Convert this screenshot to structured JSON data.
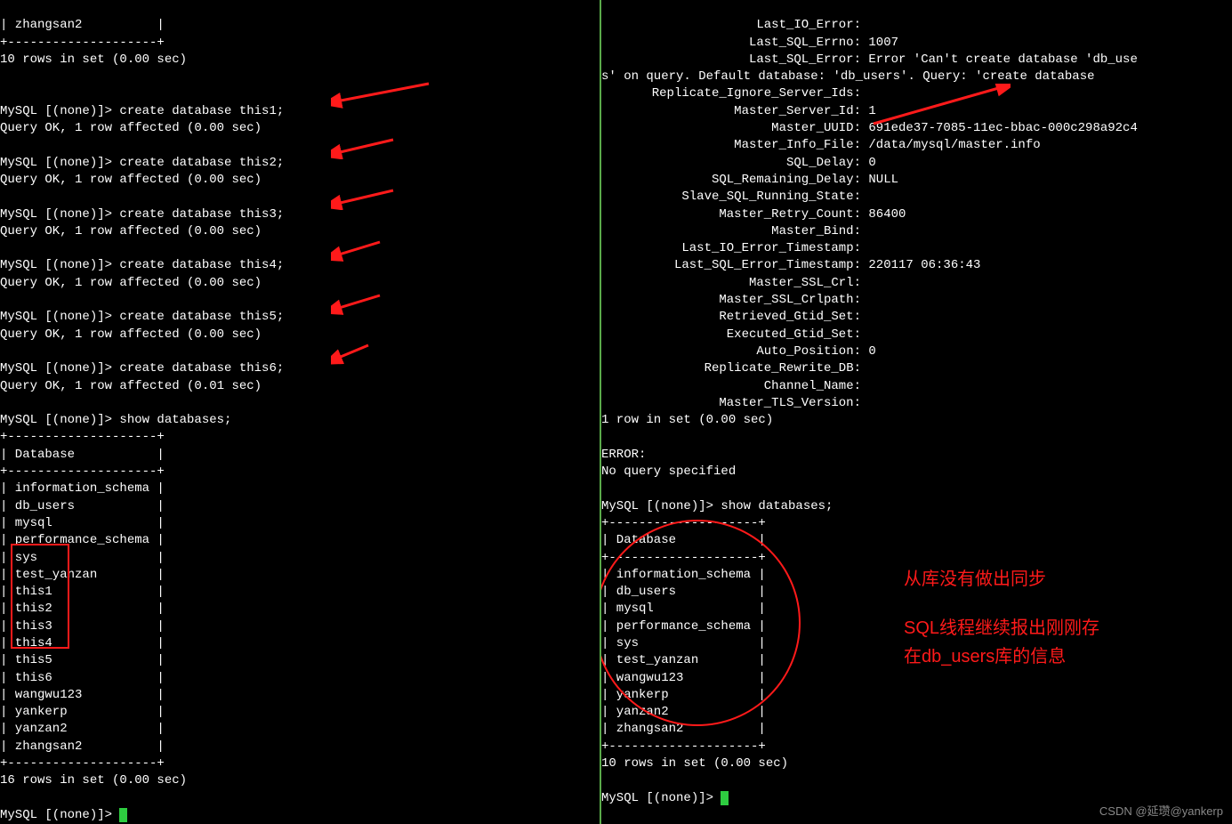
{
  "left": {
    "top_fragment": "| zhangsan2          |\n+--------------------+\n10 rows in set (0.00 sec)\n",
    "creates": [
      {
        "prompt": "MySQL [(none)]> ",
        "cmd": "create database this1;",
        "result": "Query OK, 1 row affected (0.00 sec)"
      },
      {
        "prompt": "MySQL [(none)]> ",
        "cmd": "create database this2;",
        "result": "Query OK, 1 row affected (0.00 sec)"
      },
      {
        "prompt": "MySQL [(none)]> ",
        "cmd": "create database this3;",
        "result": "Query OK, 1 row affected (0.00 sec)"
      },
      {
        "prompt": "MySQL [(none)]> ",
        "cmd": "create database this4;",
        "result": "Query OK, 1 row affected (0.00 sec)"
      },
      {
        "prompt": "MySQL [(none)]> ",
        "cmd": "create database this5;",
        "result": "Query OK, 1 row affected (0.00 sec)"
      },
      {
        "prompt": "MySQL [(none)]> ",
        "cmd": "create database this6;",
        "result": "Query OK, 1 row affected (0.01 sec)"
      }
    ],
    "show_cmd": {
      "prompt": "MySQL [(none)]> ",
      "cmd": "show databases;"
    },
    "table_border": "+--------------------+",
    "table_header": "| Database           |",
    "rows": [
      "| information_schema |",
      "| db_users           |",
      "| mysql              |",
      "| performance_schema |",
      "| sys                |",
      "| test_yanzan        |",
      "| this1              |",
      "| this2              |",
      "| this3              |",
      "| this4              |",
      "| this5              |",
      "| this6              |",
      "| wangwu123          |",
      "| yankerp            |",
      "| yanzan2            |",
      "| zhangsan2          |"
    ],
    "footer": "16 rows in set (0.00 sec)",
    "final_prompt": "MySQL [(none)]> "
  },
  "right": {
    "status_pairs": [
      [
        "Last_IO_Error:",
        ""
      ],
      [
        "Last_SQL_Errno:",
        " 1007"
      ],
      [
        "Last_SQL_Error:",
        " Error 'Can't create database 'db_use"
      ]
    ],
    "status_wrap": "s' on query. Default database: 'db_users'. Query: 'create database ",
    "status_pairs2": [
      [
        "Replicate_Ignore_Server_Ids:",
        ""
      ],
      [
        "Master_Server_Id:",
        " 1"
      ],
      [
        "Master_UUID:",
        " 691ede37-7085-11ec-bbac-000c298a92c4"
      ],
      [
        "Master_Info_File:",
        " /data/mysql/master.info"
      ],
      [
        "SQL_Delay:",
        " 0"
      ],
      [
        "SQL_Remaining_Delay:",
        " NULL"
      ],
      [
        "Slave_SQL_Running_State:",
        ""
      ],
      [
        "Master_Retry_Count:",
        " 86400"
      ],
      [
        "Master_Bind:",
        ""
      ],
      [
        "Last_IO_Error_Timestamp:",
        ""
      ],
      [
        "Last_SQL_Error_Timestamp:",
        " 220117 06:36:43"
      ],
      [
        "Master_SSL_Crl:",
        ""
      ],
      [
        "Master_SSL_Crlpath:",
        ""
      ],
      [
        "Retrieved_Gtid_Set:",
        ""
      ],
      [
        "Executed_Gtid_Set:",
        ""
      ],
      [
        "Auto_Position:",
        " 0"
      ],
      [
        "Replicate_Rewrite_DB:",
        ""
      ],
      [
        "Channel_Name:",
        ""
      ],
      [
        "Master_TLS_Version:",
        ""
      ]
    ],
    "one_row": "1 row in set (0.00 sec)",
    "error_block": "ERROR:\nNo query specified",
    "show_cmd": {
      "prompt": "MySQL [(none)]> ",
      "cmd": "show databases;"
    },
    "table_border": "+--------------------+",
    "table_header": "| Database           |",
    "rows": [
      "| information_schema |",
      "| db_users           |",
      "| mysql              |",
      "| performance_schema |",
      "| sys                |",
      "| test_yanzan        |",
      "| wangwu123          |",
      "| yankerp            |",
      "| yanzan2            |",
      "| zhangsan2          |"
    ],
    "footer": "10 rows in set (0.00 sec)",
    "final_prompt": "MySQL [(none)]> "
  },
  "annotations": {
    "line1": "从库没有做出同步",
    "line2": "SQL线程继续报出刚刚存",
    "line3": "在db_users库的信息"
  },
  "watermark": "CSDN @延瓒@yankerp"
}
